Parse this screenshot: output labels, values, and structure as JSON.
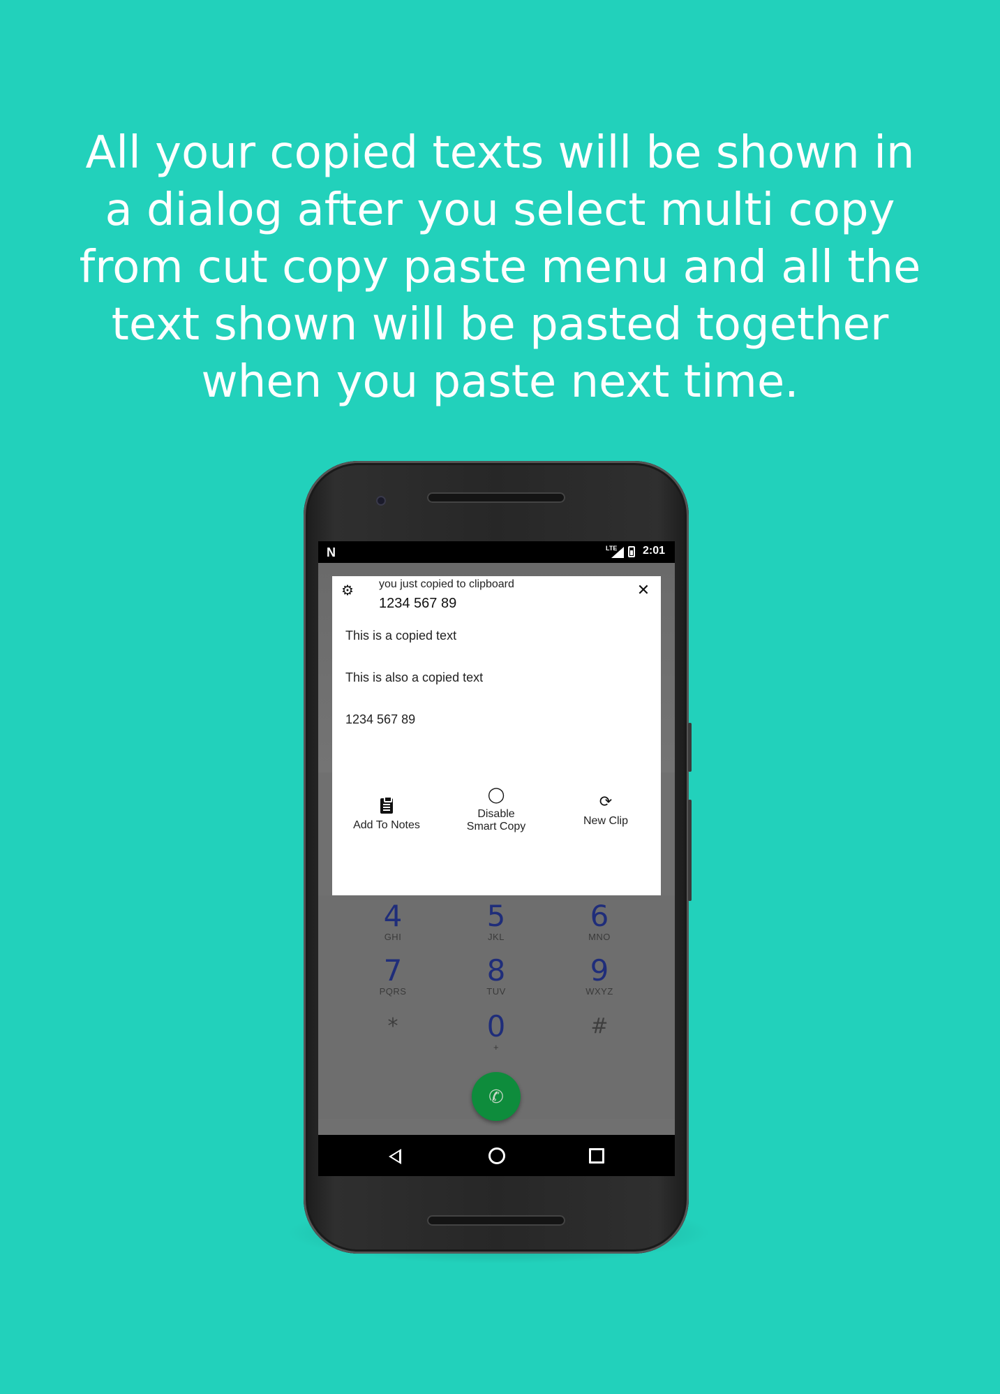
{
  "headline": {
    "lines": [
      "All your copied texts will be shown in",
      "a dialog after you select multi copy",
      "from cut copy paste menu and all the",
      "text shown will be pasted together",
      "when you paste next time."
    ]
  },
  "status_bar": {
    "network": "LTE",
    "time": "2:01"
  },
  "dialog": {
    "subtitle": "you just copied to clipboard",
    "title": "1234 567 89",
    "clips": [
      "This is a  copied text",
      "This is also a  copied text",
      "1234 567 89"
    ],
    "actions": [
      {
        "label": "Add To Notes",
        "icon": "clipboard-icon"
      },
      {
        "label_line1": "Disable",
        "label_line2": "Smart Copy",
        "icon": "lightbulb-icon"
      },
      {
        "label": "New Clip",
        "icon": "refresh-icon"
      }
    ]
  },
  "dialpad": {
    "keys": [
      {
        "num": "4",
        "letters": "GHI"
      },
      {
        "num": "5",
        "letters": "JKL"
      },
      {
        "num": "6",
        "letters": "MNO"
      },
      {
        "num": "7",
        "letters": "PQRS"
      },
      {
        "num": "8",
        "letters": "TUV"
      },
      {
        "num": "9",
        "letters": "WXYZ"
      },
      {
        "num": "*",
        "letters": ""
      },
      {
        "num": "0",
        "letters": "+"
      },
      {
        "num": "#",
        "letters": ""
      }
    ]
  },
  "colors": {
    "background": "#22d1bb",
    "call_button": "#0e8c3c",
    "dialpad_digits": "#1f2d7a"
  }
}
